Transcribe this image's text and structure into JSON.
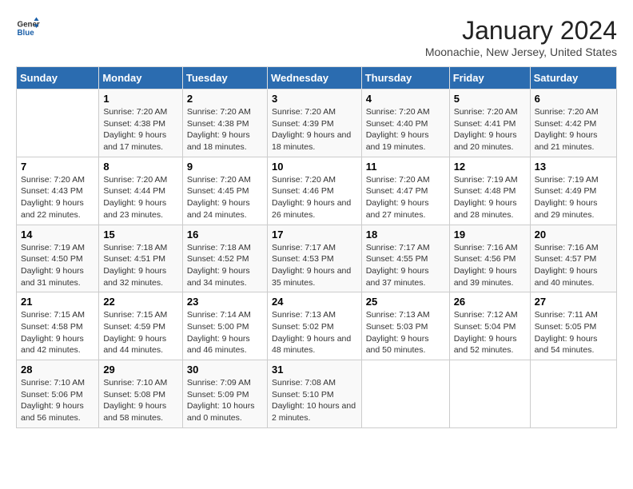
{
  "logo": {
    "text_general": "General",
    "text_blue": "Blue"
  },
  "title": "January 2024",
  "subtitle": "Moonachie, New Jersey, United States",
  "headers": [
    "Sunday",
    "Monday",
    "Tuesday",
    "Wednesday",
    "Thursday",
    "Friday",
    "Saturday"
  ],
  "weeks": [
    [
      {
        "day": "",
        "sunrise": "",
        "sunset": "",
        "daylight": ""
      },
      {
        "day": "1",
        "sunrise": "Sunrise: 7:20 AM",
        "sunset": "Sunset: 4:38 PM",
        "daylight": "Daylight: 9 hours and 17 minutes."
      },
      {
        "day": "2",
        "sunrise": "Sunrise: 7:20 AM",
        "sunset": "Sunset: 4:38 PM",
        "daylight": "Daylight: 9 hours and 18 minutes."
      },
      {
        "day": "3",
        "sunrise": "Sunrise: 7:20 AM",
        "sunset": "Sunset: 4:39 PM",
        "daylight": "Daylight: 9 hours and 18 minutes."
      },
      {
        "day": "4",
        "sunrise": "Sunrise: 7:20 AM",
        "sunset": "Sunset: 4:40 PM",
        "daylight": "Daylight: 9 hours and 19 minutes."
      },
      {
        "day": "5",
        "sunrise": "Sunrise: 7:20 AM",
        "sunset": "Sunset: 4:41 PM",
        "daylight": "Daylight: 9 hours and 20 minutes."
      },
      {
        "day": "6",
        "sunrise": "Sunrise: 7:20 AM",
        "sunset": "Sunset: 4:42 PM",
        "daylight": "Daylight: 9 hours and 21 minutes."
      }
    ],
    [
      {
        "day": "7",
        "sunrise": "Sunrise: 7:20 AM",
        "sunset": "Sunset: 4:43 PM",
        "daylight": "Daylight: 9 hours and 22 minutes."
      },
      {
        "day": "8",
        "sunrise": "Sunrise: 7:20 AM",
        "sunset": "Sunset: 4:44 PM",
        "daylight": "Daylight: 9 hours and 23 minutes."
      },
      {
        "day": "9",
        "sunrise": "Sunrise: 7:20 AM",
        "sunset": "Sunset: 4:45 PM",
        "daylight": "Daylight: 9 hours and 24 minutes."
      },
      {
        "day": "10",
        "sunrise": "Sunrise: 7:20 AM",
        "sunset": "Sunset: 4:46 PM",
        "daylight": "Daylight: 9 hours and 26 minutes."
      },
      {
        "day": "11",
        "sunrise": "Sunrise: 7:20 AM",
        "sunset": "Sunset: 4:47 PM",
        "daylight": "Daylight: 9 hours and 27 minutes."
      },
      {
        "day": "12",
        "sunrise": "Sunrise: 7:19 AM",
        "sunset": "Sunset: 4:48 PM",
        "daylight": "Daylight: 9 hours and 28 minutes."
      },
      {
        "day": "13",
        "sunrise": "Sunrise: 7:19 AM",
        "sunset": "Sunset: 4:49 PM",
        "daylight": "Daylight: 9 hours and 29 minutes."
      }
    ],
    [
      {
        "day": "14",
        "sunrise": "Sunrise: 7:19 AM",
        "sunset": "Sunset: 4:50 PM",
        "daylight": "Daylight: 9 hours and 31 minutes."
      },
      {
        "day": "15",
        "sunrise": "Sunrise: 7:18 AM",
        "sunset": "Sunset: 4:51 PM",
        "daylight": "Daylight: 9 hours and 32 minutes."
      },
      {
        "day": "16",
        "sunrise": "Sunrise: 7:18 AM",
        "sunset": "Sunset: 4:52 PM",
        "daylight": "Daylight: 9 hours and 34 minutes."
      },
      {
        "day": "17",
        "sunrise": "Sunrise: 7:17 AM",
        "sunset": "Sunset: 4:53 PM",
        "daylight": "Daylight: 9 hours and 35 minutes."
      },
      {
        "day": "18",
        "sunrise": "Sunrise: 7:17 AM",
        "sunset": "Sunset: 4:55 PM",
        "daylight": "Daylight: 9 hours and 37 minutes."
      },
      {
        "day": "19",
        "sunrise": "Sunrise: 7:16 AM",
        "sunset": "Sunset: 4:56 PM",
        "daylight": "Daylight: 9 hours and 39 minutes."
      },
      {
        "day": "20",
        "sunrise": "Sunrise: 7:16 AM",
        "sunset": "Sunset: 4:57 PM",
        "daylight": "Daylight: 9 hours and 40 minutes."
      }
    ],
    [
      {
        "day": "21",
        "sunrise": "Sunrise: 7:15 AM",
        "sunset": "Sunset: 4:58 PM",
        "daylight": "Daylight: 9 hours and 42 minutes."
      },
      {
        "day": "22",
        "sunrise": "Sunrise: 7:15 AM",
        "sunset": "Sunset: 4:59 PM",
        "daylight": "Daylight: 9 hours and 44 minutes."
      },
      {
        "day": "23",
        "sunrise": "Sunrise: 7:14 AM",
        "sunset": "Sunset: 5:00 PM",
        "daylight": "Daylight: 9 hours and 46 minutes."
      },
      {
        "day": "24",
        "sunrise": "Sunrise: 7:13 AM",
        "sunset": "Sunset: 5:02 PM",
        "daylight": "Daylight: 9 hours and 48 minutes."
      },
      {
        "day": "25",
        "sunrise": "Sunrise: 7:13 AM",
        "sunset": "Sunset: 5:03 PM",
        "daylight": "Daylight: 9 hours and 50 minutes."
      },
      {
        "day": "26",
        "sunrise": "Sunrise: 7:12 AM",
        "sunset": "Sunset: 5:04 PM",
        "daylight": "Daylight: 9 hours and 52 minutes."
      },
      {
        "day": "27",
        "sunrise": "Sunrise: 7:11 AM",
        "sunset": "Sunset: 5:05 PM",
        "daylight": "Daylight: 9 hours and 54 minutes."
      }
    ],
    [
      {
        "day": "28",
        "sunrise": "Sunrise: 7:10 AM",
        "sunset": "Sunset: 5:06 PM",
        "daylight": "Daylight: 9 hours and 56 minutes."
      },
      {
        "day": "29",
        "sunrise": "Sunrise: 7:10 AM",
        "sunset": "Sunset: 5:08 PM",
        "daylight": "Daylight: 9 hours and 58 minutes."
      },
      {
        "day": "30",
        "sunrise": "Sunrise: 7:09 AM",
        "sunset": "Sunset: 5:09 PM",
        "daylight": "Daylight: 10 hours and 0 minutes."
      },
      {
        "day": "31",
        "sunrise": "Sunrise: 7:08 AM",
        "sunset": "Sunset: 5:10 PM",
        "daylight": "Daylight: 10 hours and 2 minutes."
      },
      {
        "day": "",
        "sunrise": "",
        "sunset": "",
        "daylight": ""
      },
      {
        "day": "",
        "sunrise": "",
        "sunset": "",
        "daylight": ""
      },
      {
        "day": "",
        "sunrise": "",
        "sunset": "",
        "daylight": ""
      }
    ]
  ]
}
